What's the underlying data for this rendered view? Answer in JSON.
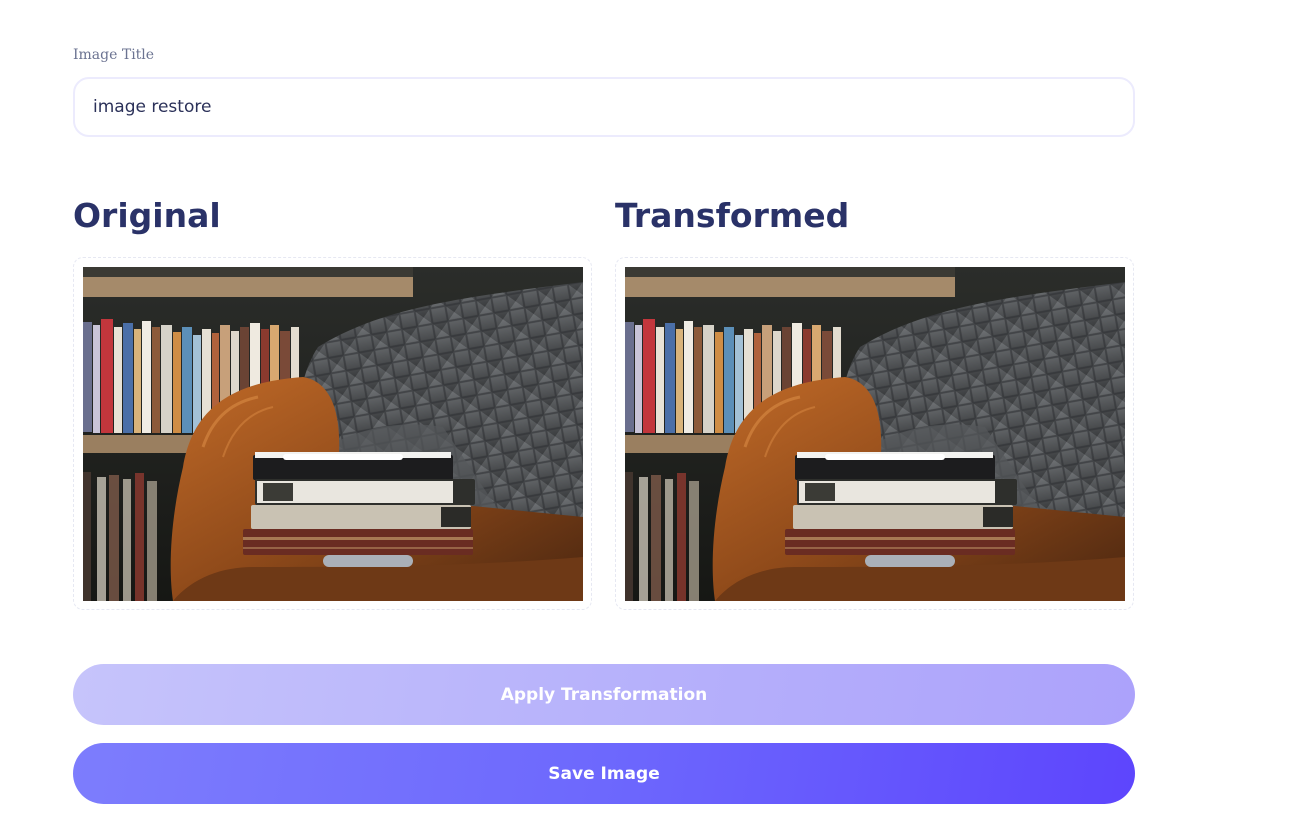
{
  "form": {
    "title_label": "Image Title",
    "title_value": "image restore"
  },
  "original": {
    "heading": "Original",
    "image_alt": "books on a leather armchair"
  },
  "transformed": {
    "heading": "Transformed",
    "image_alt": "books on a leather armchair"
  },
  "actions": {
    "apply_label": "Apply Transformation",
    "save_label": "Save Image"
  },
  "colors": {
    "heading": "#2a3268",
    "apply_button": "#b7b2fb",
    "save_button": "#6d68fd"
  }
}
